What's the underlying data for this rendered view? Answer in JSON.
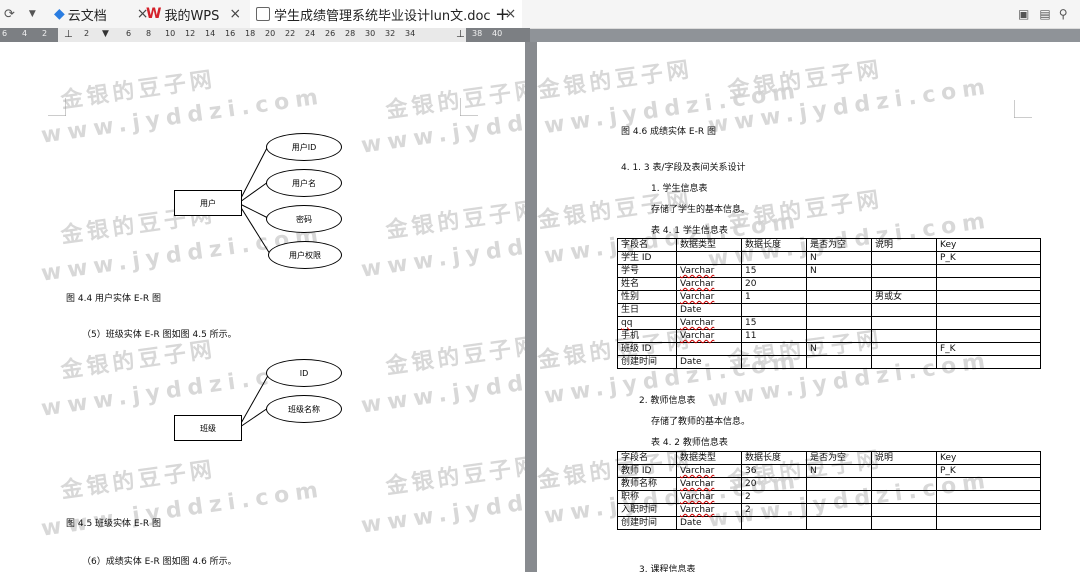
{
  "tabs": [
    {
      "label": "云文档"
    },
    {
      "label": "我的WPS"
    },
    {
      "label": "学生成绩管理系统毕业设计lun文.doc"
    }
  ],
  "ruler": {
    "ticks": [
      "6",
      "4",
      "2",
      "2",
      "6",
      "8",
      "10",
      "12",
      "14",
      "16",
      "18",
      "20",
      "22",
      "24",
      "26",
      "28",
      "30",
      "32",
      "34",
      "38",
      "40"
    ]
  },
  "watermark": {
    "cn": "金银的豆子网",
    "en": "www.jyddzi.com"
  },
  "left_page": {
    "fig44": {
      "entity": "用户",
      "attrs": [
        "用户ID",
        "用户名",
        "密码",
        "用户权限"
      ],
      "caption": "图 4.4   用户实体 E-R 图"
    },
    "para5": "（5）班级实体 E-R 图如图 4.5 所示。",
    "fig45": {
      "entity": "班级",
      "attrs": [
        "ID",
        "班级名称"
      ],
      "caption": "图 4.5   班级实体 E-R 图"
    },
    "para6": "（6）成绩实体 E-R 图如图 4.6 所示。"
  },
  "right_page": {
    "fig46_caption": "图 4.6   成绩实体 E-R 图",
    "section": "4. 1. 3   表/字段及表间关系设计",
    "item1": "1.  学生信息表",
    "item1_desc": "存储了学生的基本信息。",
    "table1_title": "表 4. 1    学生信息表",
    "table1": {
      "headers": [
        "字段名",
        "数据类型",
        "数据长度",
        "是否为空",
        "说明",
        "Key"
      ],
      "rows": [
        [
          "学生 ID",
          "",
          "",
          "N",
          "",
          "P_K"
        ],
        [
          "学号",
          "Varchar",
          "15",
          "N",
          "",
          ""
        ],
        [
          "姓名",
          "Varchar",
          "20",
          "",
          "",
          ""
        ],
        [
          "性别",
          "Varchar",
          "1",
          "",
          "男或女",
          ""
        ],
        [
          "生日",
          "Date",
          "",
          "",
          "",
          ""
        ],
        [
          "qq",
          "Varchar",
          "15",
          "",
          "",
          ""
        ],
        [
          "手机",
          "Varchar",
          "11",
          "",
          "",
          ""
        ],
        [
          "班级 ID",
          "",
          "",
          "N",
          "",
          "F_K"
        ],
        [
          "创建时间",
          "Date",
          "",
          "",
          "",
          ""
        ]
      ]
    },
    "item2": "2.  教师信息表",
    "item2_desc": "存储了教师的基本信息。",
    "table2_title": "表 4. 2    教师信息表",
    "table2": {
      "headers": [
        "字段名",
        "数据类型",
        "数据长度",
        "是否为空",
        "说明",
        "Key"
      ],
      "rows": [
        [
          "教师 ID",
          "Varchar",
          "36",
          "N",
          "",
          "P_K"
        ],
        [
          "教师名称",
          "Varchar",
          "20",
          "",
          "",
          ""
        ],
        [
          "职称",
          "Varchar",
          "2",
          "",
          "",
          ""
        ],
        [
          "入职时间",
          "Varchar",
          "2",
          "",
          "",
          ""
        ],
        [
          "创建时间",
          "Date",
          "",
          "",
          "",
          ""
        ]
      ]
    },
    "item3": "3.  课程信息表"
  }
}
